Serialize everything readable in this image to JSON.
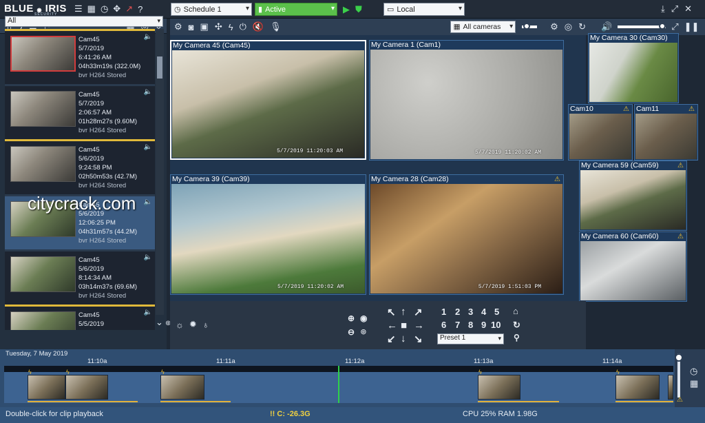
{
  "app": {
    "logo_main": "BLUE",
    "logo_sub": "IRIS",
    "logo_tag": "SECURITY"
  },
  "toolbar": {
    "schedule": "Schedule 1",
    "profile": "Active",
    "location": "Local",
    "camera_group": "All cameras"
  },
  "clips": {
    "filter": "All",
    "items": [
      {
        "camera": "Cam45",
        "date": "5/7/2019",
        "time": "6:41:26 AM",
        "duration": "04h33m19s (322.0M)",
        "type": "bvr H264 Stored"
      },
      {
        "camera": "Cam45",
        "date": "5/7/2019",
        "time": "2:06:57 AM",
        "duration": "01h28m27s (9.60M)",
        "type": "bvr H264 Stored"
      },
      {
        "camera": "Cam45",
        "date": "5/6/2019",
        "time": "9:24:58 PM",
        "duration": "02h50m53s (42.7M)",
        "type": "bvr H264 Stored"
      },
      {
        "camera": "Cam45",
        "date": "5/6/2019",
        "time": "12:06:25 PM",
        "duration": "04h31m57s (44.2M)",
        "type": "bvr H264 Stored"
      },
      {
        "camera": "Cam45",
        "date": "5/6/2019",
        "time": "8:14:34 AM",
        "duration": "03h14m37s (69.6M)",
        "type": "bvr H264 Stored"
      },
      {
        "camera": "Cam45",
        "date": "5/5/2019",
        "time": "",
        "duration": "",
        "type": ""
      }
    ]
  },
  "watermark": "citycrack.com",
  "cameras": [
    {
      "title": "My Camera 45 (Cam45)",
      "stamp": "5/7/2019 11:20:03 AM",
      "warn": ""
    },
    {
      "title": "My Camera 1 (Cam1)",
      "stamp": "5/7/2019 11:20:02 AM",
      "warn": ""
    },
    {
      "title": "My Camera 39 (Cam39)",
      "stamp": "5/7/2019 11:20:02 AM",
      "warn": ""
    },
    {
      "title": "My Camera 28 (Cam28)",
      "stamp": "5/7/2019 1:51:03 PM",
      "warn": "⚠"
    },
    {
      "title": "My Camera 30 (Cam30)",
      "stamp": "",
      "warn": ""
    },
    {
      "title": "Cam10",
      "stamp": "",
      "warn": "⚠"
    },
    {
      "title": "Cam11",
      "stamp": "",
      "warn": "⚠"
    },
    {
      "title": "My Camera 59 (Cam59)",
      "stamp": "",
      "warn": "⚠"
    },
    {
      "title": "My Camera 60 (Cam60)",
      "stamp": "",
      "warn": "⚠"
    }
  ],
  "ptz": {
    "preset": "Preset 1",
    "numbers_row1": [
      "1",
      "2",
      "3",
      "4",
      "5"
    ],
    "numbers_row2": [
      "6",
      "7",
      "8",
      "9",
      "10"
    ]
  },
  "timeline": {
    "date": "Tuesday, 7 May 2019",
    "ticks": [
      "11:10a",
      "11:11a",
      "11:12a",
      "11:13a",
      "11:14a"
    ]
  },
  "status": {
    "hint": "Double-click for clip playback",
    "disk": "!! C: -26.3G",
    "usage": "CPU 25% RAM 1.98G"
  }
}
